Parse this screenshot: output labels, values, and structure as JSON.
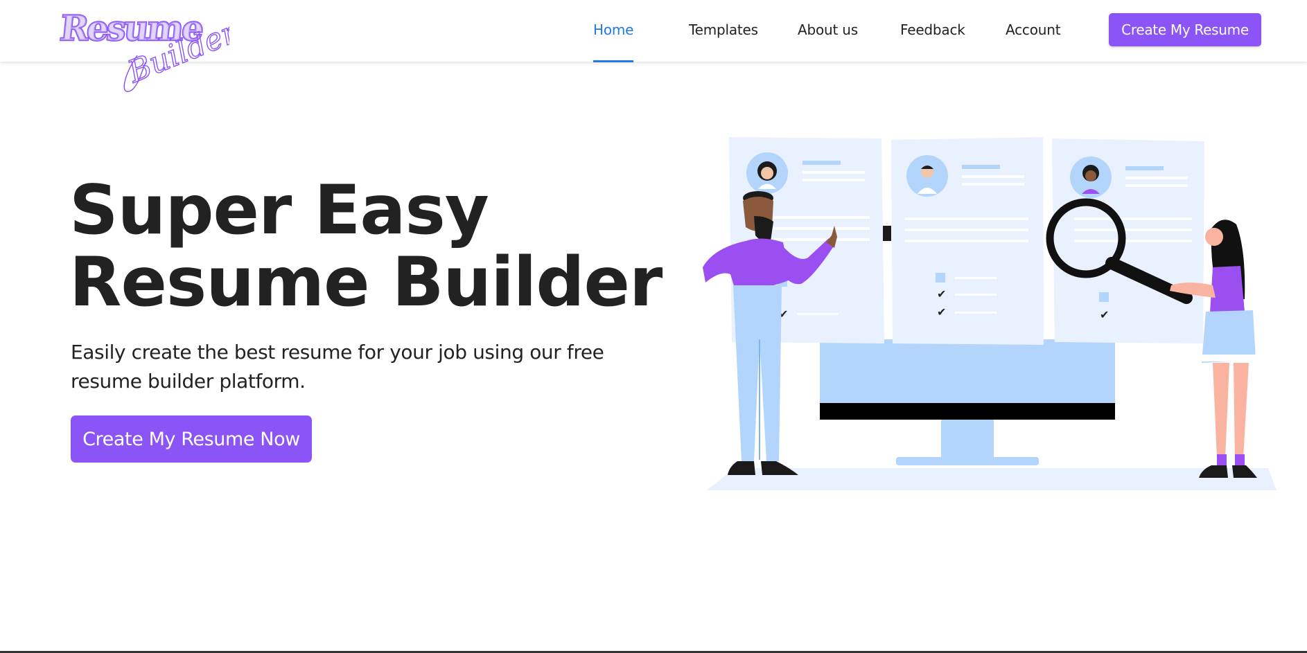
{
  "brand": {
    "logo_text_top": "Resume",
    "logo_text_bottom": "Builder",
    "color": "#8a54f7"
  },
  "nav": {
    "items": [
      {
        "label": "Home",
        "active": true
      },
      {
        "label": "Templates",
        "active": false
      },
      {
        "label": "About us",
        "active": false
      },
      {
        "label": "Feedback",
        "active": false
      },
      {
        "label": "Account",
        "active": false
      }
    ],
    "cta_label": "Create My Resume",
    "active_color": "#1f7ae8"
  },
  "hero": {
    "title_line1": "Super Easy",
    "title_line2": "Resume Builder",
    "subtitle": "Easily create the best resume for your job using our free resume builder platform.",
    "cta_label": "Create My Resume Now"
  },
  "illustration": {
    "icon": "resume-review-illustration",
    "colors": {
      "purple": "#9b4ff0",
      "light_blue": "#b3d4fb",
      "pale_blue": "#e8f1fd"
    }
  }
}
